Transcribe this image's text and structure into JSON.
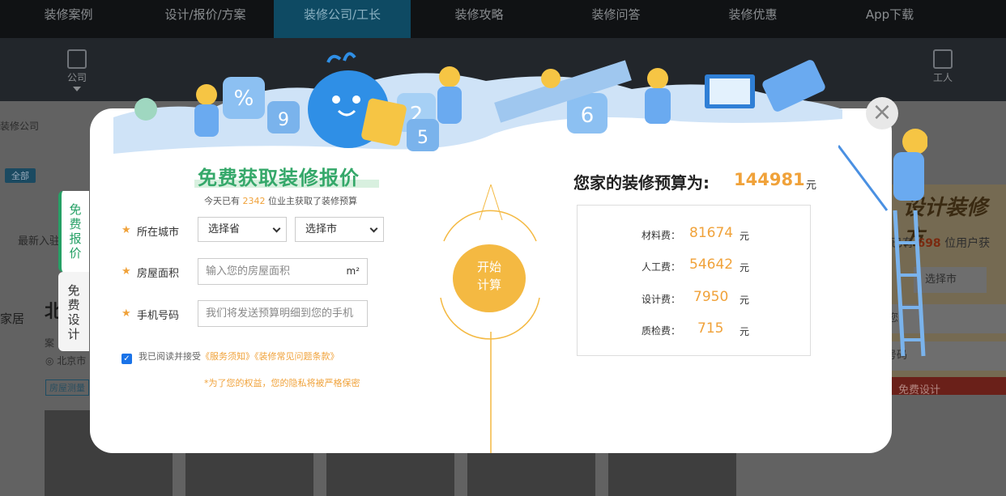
{
  "topnav": {
    "items": [
      "装修案例",
      "设计/报价/方案",
      "装修公司/工长",
      "装修攻略",
      "装修问答",
      "装修优惠",
      "App下载"
    ],
    "active_index": 2
  },
  "subnav": {
    "company_label": "公司",
    "worker_label": "工人"
  },
  "background": {
    "breadcrumb": "装修公司",
    "filter_tag": "全部",
    "sort_label": "最新入驻",
    "logo_text": "家居",
    "company_name": "北",
    "company_sub": "案",
    "location": "北京市",
    "service_tag": "房屋测量",
    "side_title": "设计装修方",
    "side_count_prefix": "已有",
    "side_count": "698",
    "side_count_suffix": "位用户获",
    "side_select": "选择市",
    "side_input1": "您",
    "side_input2": "您的手机号码",
    "side_button": "免费设计"
  },
  "modal": {
    "close_symbol": "×",
    "tabs": [
      {
        "label": [
          "免",
          "费",
          "报",
          "价"
        ]
      },
      {
        "label": [
          "免",
          "费",
          "设",
          "计"
        ]
      }
    ],
    "title": "免费获取装修报价",
    "subtitle_prefix": "今天已有",
    "subtitle_count": "2342",
    "subtitle_suffix": "位业主获取了装修预算",
    "form": {
      "city_label": "所在城市",
      "province_select": "选择省",
      "city_select": "选择市",
      "area_label": "房屋面积",
      "area_placeholder": "输入您的房屋面积",
      "area_unit": "m²",
      "phone_label": "手机号码",
      "phone_placeholder": "我们将发送预算明细到您的手机",
      "agree_prefix": "我已阅读并接受",
      "agree_link1": "《服务须知》",
      "agree_link2": "《装修常见问题条款》",
      "privacy": "*为了您的权益，您的隐私将被严格保密"
    },
    "start_button": [
      "开始",
      "计算"
    ],
    "result": {
      "title": "您家的装修预算为:",
      "total": "144981",
      "unit": "元",
      "items": [
        {
          "label": "材料费：",
          "value": "81674",
          "unit": "元"
        },
        {
          "label": "人工费：",
          "value": "54642",
          "unit": "元"
        },
        {
          "label": "设计费：",
          "value": "7950",
          "unit": "元"
        },
        {
          "label": "质检费：",
          "value": "715",
          "unit": "元"
        }
      ]
    }
  },
  "colors": {
    "accent_green": "#35a86a",
    "accent_orange": "#f0a23a",
    "banner_blue": "#4a90e2"
  }
}
